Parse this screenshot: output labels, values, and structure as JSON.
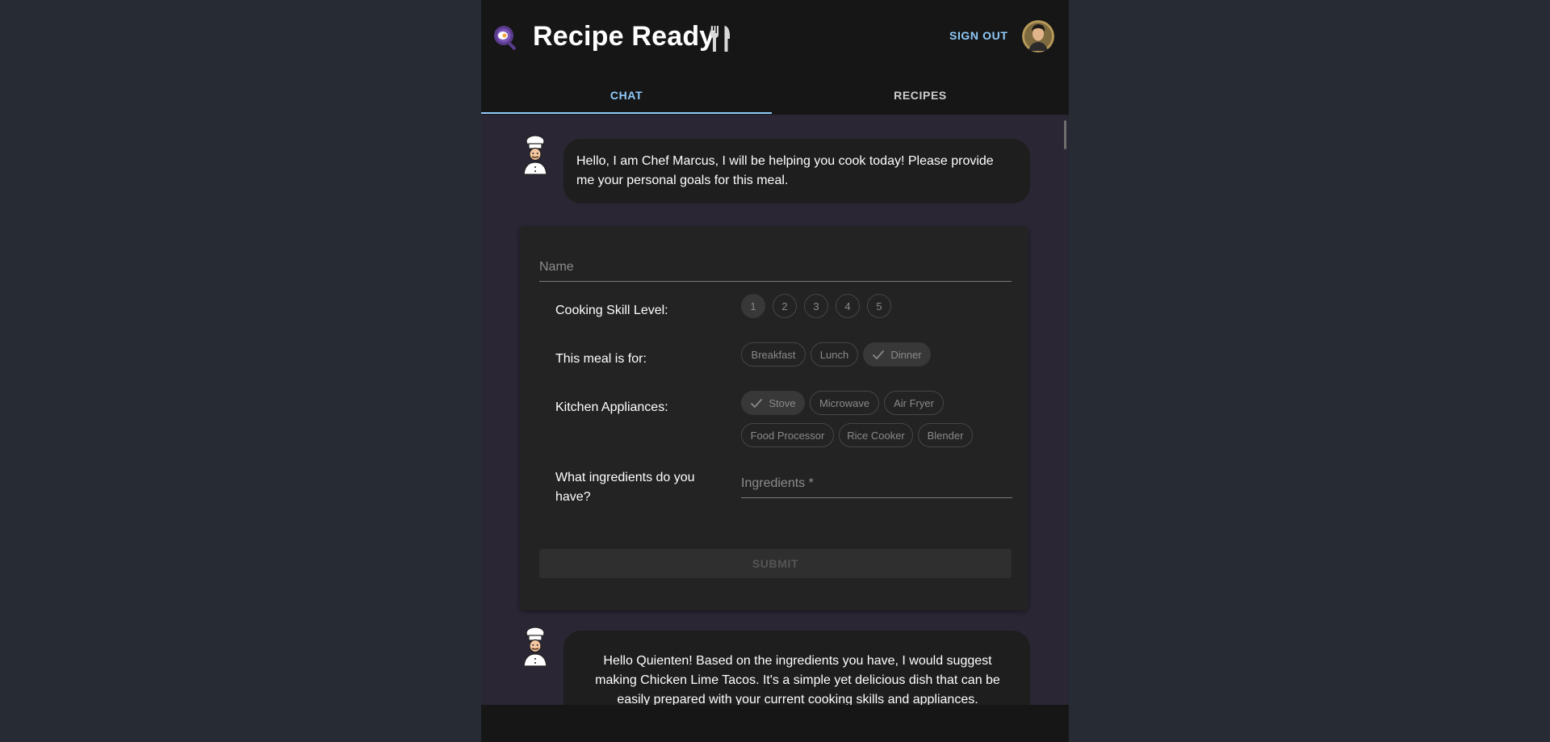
{
  "header": {
    "title": "Recipe Ready",
    "sign_out": "SIGN OUT"
  },
  "tabs": [
    {
      "label": "CHAT",
      "active": true
    },
    {
      "label": "RECIPES",
      "active": false
    }
  ],
  "messages": [
    {
      "sender": "chef",
      "text": "Hello, I am Chef Marcus, I will be helping you cook today! Please provide me your personal goals for this meal."
    },
    {
      "sender": "chef",
      "text": "Hello Quienten! Based on the ingredients you have, I would suggest making Chicken Lime Tacos. It's a simple yet delicious dish that can be easily prepared with your current cooking skills and appliances."
    }
  ],
  "form": {
    "name_placeholder": "Name",
    "skill_label": "Cooking Skill Level:",
    "skill_levels": [
      "1",
      "2",
      "3",
      "4",
      "5"
    ],
    "skill_selected": "1",
    "meal_label": "This meal is for:",
    "meals": [
      {
        "label": "Breakfast",
        "selected": false
      },
      {
        "label": "Lunch",
        "selected": false
      },
      {
        "label": "Dinner",
        "selected": true
      }
    ],
    "appliances_label": "Kitchen Appliances:",
    "appliances": [
      {
        "label": "Stove",
        "selected": true
      },
      {
        "label": "Microwave",
        "selected": false
      },
      {
        "label": "Air Fryer",
        "selected": false
      },
      {
        "label": "Food Processor",
        "selected": false
      },
      {
        "label": "Rice Cooker",
        "selected": false
      },
      {
        "label": "Blender",
        "selected": false
      }
    ],
    "ingredients_label": "What ingredients do you have?",
    "ingredients_placeholder": "Ingredients *",
    "submit": "SUBMIT"
  },
  "icons": {
    "logo": "frying-pan-egg-icon",
    "title_icon": "fork-knife-icon",
    "chef_avatar": "chef-icon",
    "check": "check-icon"
  },
  "colors": {
    "accent": "#90caf9",
    "header_bg": "#161616",
    "chat_bg": "#2a2634",
    "bubble_bg": "#1e1e1e",
    "form_bg": "#232323"
  }
}
